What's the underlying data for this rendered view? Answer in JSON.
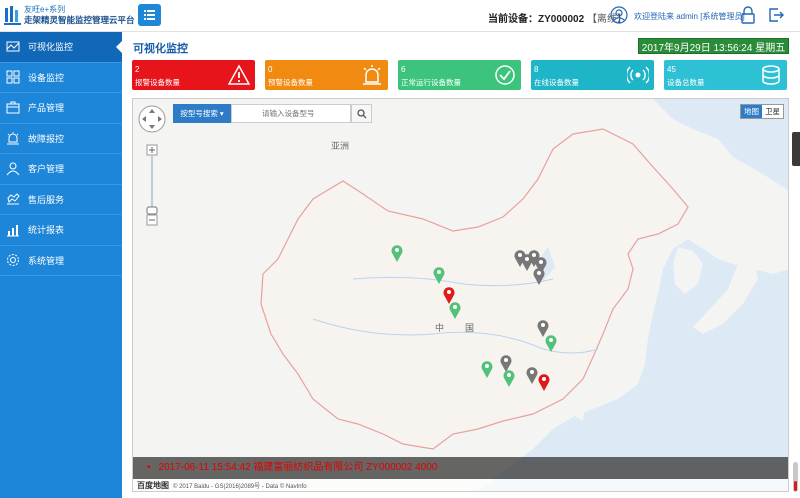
{
  "header": {
    "brand_line1": "友旺e+系列",
    "brand_line2": "走架精灵智能监控管理云平台",
    "device_label": "当前设备：ZY000002",
    "device_status": "【离线】",
    "welcome": "欢迎登陆来 admin [系统管理员]"
  },
  "sidebar": {
    "items": [
      {
        "label": "可视化监控",
        "icon": "monitor-icon",
        "active": true
      },
      {
        "label": "设备监控",
        "icon": "device-grid-icon"
      },
      {
        "label": "产品管理",
        "icon": "product-icon"
      },
      {
        "label": "故障报控",
        "icon": "alarm-icon"
      },
      {
        "label": "客户管理",
        "icon": "person-icon"
      },
      {
        "label": "售后服务",
        "icon": "service-icon"
      },
      {
        "label": "统计报表",
        "icon": "chart-icon"
      },
      {
        "label": "系统管理",
        "icon": "settings-icon"
      }
    ]
  },
  "main": {
    "title": "可视化监控",
    "clock": "2017年9月29日  13:56:24 星期五",
    "cards": [
      {
        "count": "2",
        "label": "报警设备数量",
        "color": "#e8141c",
        "icon": "warning-icon"
      },
      {
        "count": "0",
        "label": "预警设备数量",
        "color": "#f08a10",
        "icon": "siren-icon"
      },
      {
        "count": "6",
        "label": "正常运行设备数量",
        "color": "#3cc47c",
        "icon": "check-circle-icon"
      },
      {
        "count": "8",
        "label": "在线设备数量",
        "color": "#1fb5c9",
        "icon": "signal-icon"
      },
      {
        "count": "45",
        "label": "设备总数量",
        "color": "#2ec0d4",
        "icon": "database-icon"
      }
    ]
  },
  "map": {
    "search_type": "按型号搜索",
    "search_placeholder": "请输入设备型号",
    "type_map": "地图",
    "type_satellite": "卫星",
    "region_label": "亚洲",
    "country_label_1": "中",
    "country_label_2": "国",
    "ticker": "2017-06-11 15:54:42 福建富丽纺织品有限公司 ZY000002 4000",
    "copyright_brand": "百度地图",
    "copyright": "© 2017 Baidu - GS(2016)2089号 - Data © NavInfo"
  }
}
